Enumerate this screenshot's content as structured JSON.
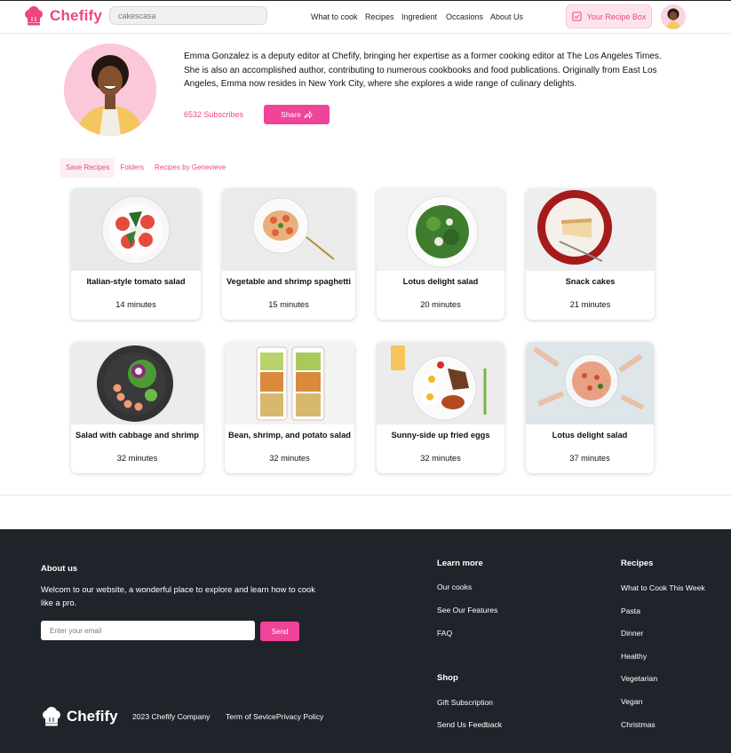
{
  "brand": {
    "name": "Chefify",
    "color": "#f0447f"
  },
  "header": {
    "search_value": "cakescasa",
    "nav": [
      "What to cook",
      "Recipes",
      "Ingredient",
      "Occasions",
      "About Us"
    ],
    "recipe_box_label": "Your Recipe Box",
    "icons": {
      "recipe_box": "checklist-icon",
      "avatar": "user-avatar"
    }
  },
  "profile": {
    "bio": "Emma Gonzalez is a deputy editor at Chefify, bringing her expertise as a former cooking editor at The Los Angeles Times. She is also an accomplished author, contributing to numerous cookbooks and food publications. Originally from East Los Angeles, Emma now resides in New York City, where she explores a wide range of culinary delights.",
    "subscribes": "6532 Subscribes",
    "share_label": "Share"
  },
  "tabs": [
    {
      "label": "Save Recipes",
      "active": true
    },
    {
      "label": "Folders",
      "active": false
    },
    {
      "label": "Recipes by Genevieve",
      "active": false
    }
  ],
  "recipes": [
    {
      "title": "Italian-style tomato salad",
      "time": "14 minutes"
    },
    {
      "title": "Vegetable and shrimp spaghetti",
      "time": "15 minutes"
    },
    {
      "title": "Lotus delight salad",
      "time": "20 minutes"
    },
    {
      "title": "Snack cakes",
      "time": "21 minutes"
    },
    {
      "title": "Salad with cabbage and shrimp",
      "time": "32 minutes"
    },
    {
      "title": "Bean, shrimp, and potato salad",
      "time": "32 minutes"
    },
    {
      "title": "Sunny-side up fried eggs",
      "time": "32 minutes"
    },
    {
      "title": "Lotus delight salad",
      "time": "37 minutes"
    }
  ],
  "footer": {
    "about_heading": "About us",
    "about_text": "Welcom to our website, a wonderful place to explore and learn how to cook like a pro.",
    "email_placeholder": "Enter your email",
    "send_label": "Send",
    "learn_more": {
      "heading": "Learn more",
      "links": [
        "Our cooks",
        "See Our Features",
        "FAQ"
      ]
    },
    "shop": {
      "heading": "Shop",
      "links": [
        "Gift Subscription",
        "Send Us Feedback"
      ]
    },
    "recipes": {
      "heading": "Recipes",
      "links": [
        "What to Cook This Week",
        "Pasta",
        "Dinner",
        "Healthy",
        "Vegetarian",
        "Vegan",
        "Christmas"
      ]
    },
    "copyright": "2023 Chefify Company",
    "terms": "Term of Sevice",
    "privacy": "Privacy Policy"
  }
}
